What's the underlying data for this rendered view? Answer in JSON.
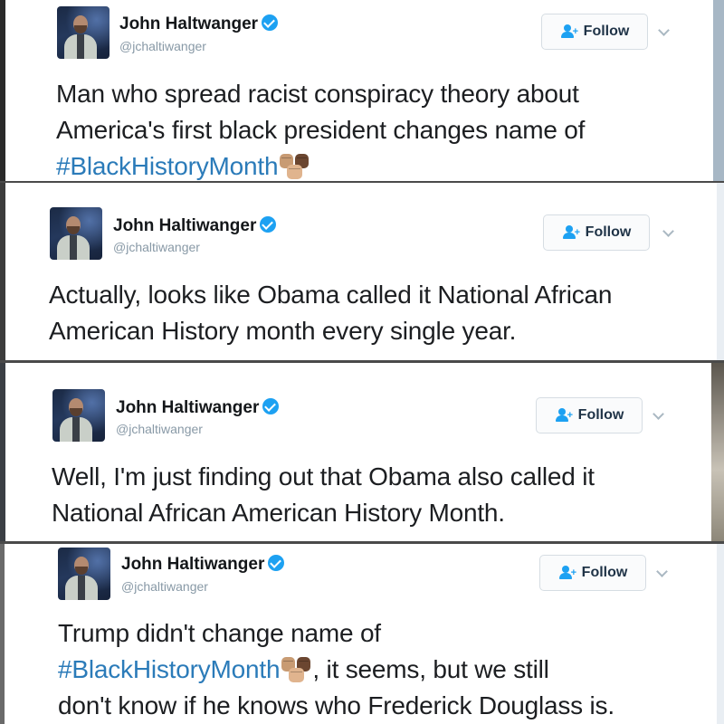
{
  "tweets": [
    {
      "name": "John Haltwanger",
      "handle": "@jchaltiwanger",
      "follow_label": "Follow",
      "lines": [
        "Man who spread racist conspiracy theory about",
        "America's first black president changes name of"
      ],
      "hashtag": "#BlackHistoryMonth"
    },
    {
      "name": "John Haltiwanger",
      "handle": "@jchaltiwanger",
      "follow_label": "Follow",
      "lines": [
        "Actually, looks like Obama called it National African",
        "American History month every single year."
      ]
    },
    {
      "name": "John Haltiwanger",
      "handle": "@jchaltiwanger",
      "follow_label": "Follow",
      "lines": [
        "Well, I'm just finding out that Obama also called it",
        "National African American History Month."
      ]
    },
    {
      "name": "John Haltiwanger",
      "handle": "@jchaltiwanger",
      "follow_label": "Follow",
      "lines": [
        "Trump didn't change name of",
        ", it seems, but we still",
        "don't know if he knows who Frederick Douglass is."
      ],
      "hashtag": "#BlackHistoryMonth"
    }
  ],
  "colors": {
    "hashtag": "#2b7bb9",
    "verified_badge": "#1da1f2",
    "follow_icon": "#1da1f2"
  },
  "icons": [
    "verified-icon",
    "follow-person-icon",
    "chevron-down-icon",
    "raised-fists-emoji"
  ]
}
